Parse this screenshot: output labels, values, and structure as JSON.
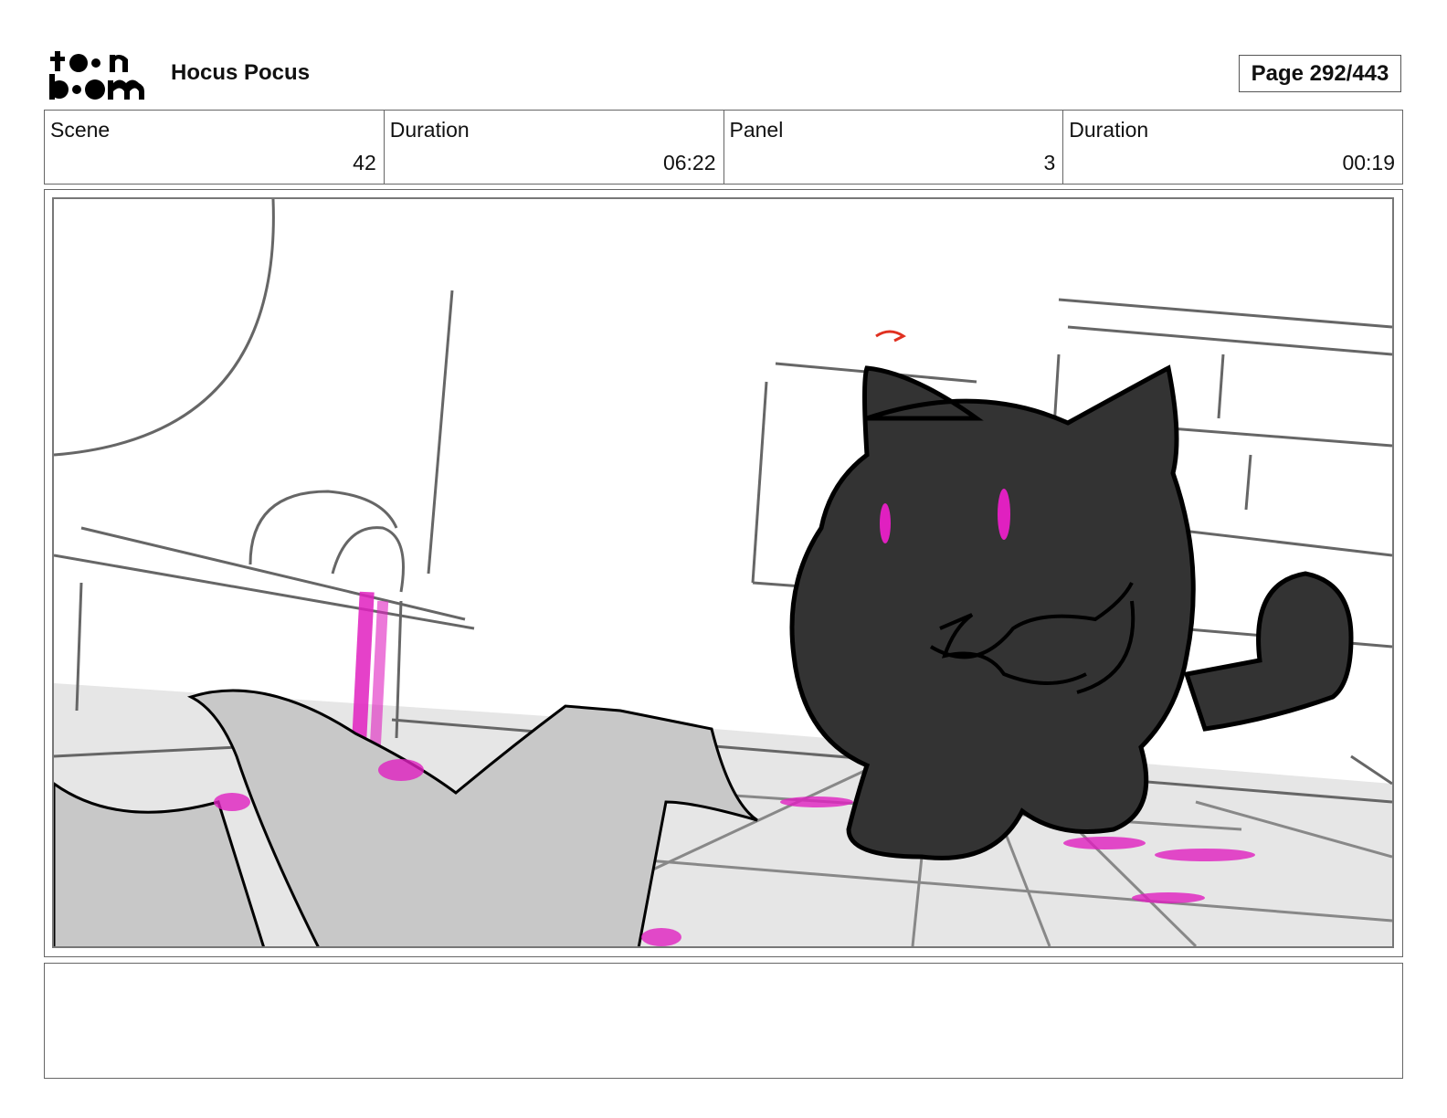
{
  "header": {
    "logo_text_top": "toon",
    "logo_text_bottom": "boom",
    "project_title": "Hocus Pocus",
    "page_label": "Page 292/443"
  },
  "info": {
    "scene_label": "Scene",
    "scene_value": "42",
    "scene_duration_label": "Duration",
    "scene_duration_value": "06:22",
    "panel_label": "Panel",
    "panel_value": "3",
    "panel_duration_label": "Duration",
    "panel_duration_value": "00:19"
  },
  "panel": {
    "image_icon": "storyboard-sketch-black-cat-icon",
    "colors": {
      "cat": "#333333",
      "magenta": "#e020c0",
      "floor": "#e6e6e6",
      "cloth": "#c8c8c8"
    }
  },
  "notes": {
    "text": ""
  }
}
